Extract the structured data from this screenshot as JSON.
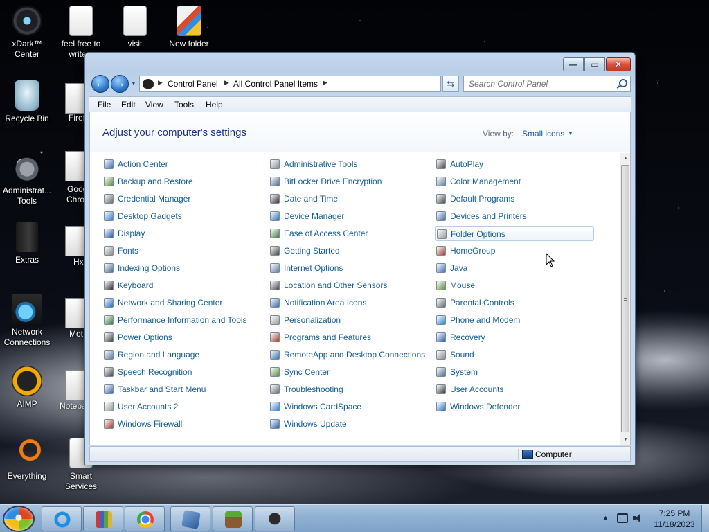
{
  "desktop": {
    "icons": [
      {
        "label": "xDark™ Center",
        "icon": "xdark-icon"
      },
      {
        "label": "feel free to write a",
        "icon": "document-icon"
      },
      {
        "label": "visit",
        "icon": "document-icon"
      },
      {
        "label": "New folder",
        "icon": "folder-icon"
      },
      {
        "label": "Recycle Bin",
        "icon": "recycle-bin-icon"
      },
      {
        "label": "Administrat... Tools",
        "icon": "admin-tools-icon"
      },
      {
        "label": "Extras",
        "icon": "folder-icon"
      },
      {
        "label": "Network Connections",
        "icon": "network-icon"
      },
      {
        "label": "AIMP",
        "icon": "aimp-icon"
      },
      {
        "label": "Everything",
        "icon": "everything-icon"
      },
      {
        "label": "Smart Services",
        "icon": "app-icon"
      }
    ],
    "partial_labels": [
      "Firef",
      "Goog",
      "Chro",
      "Hxl",
      "Mot",
      "Notepa"
    ]
  },
  "window": {
    "controls": {
      "minimize": "—",
      "maximize": "▭",
      "close": "✕"
    },
    "address": {
      "crumbs": [
        "Control Panel",
        "All Control Panel Items"
      ],
      "search_placeholder": "Search Control Panel"
    },
    "menu": [
      "File",
      "Edit",
      "View",
      "Tools",
      "Help"
    ],
    "title": "Adjust your computer's settings",
    "view_by_label": "View by:",
    "view_by_value": "Small icons",
    "columns": [
      [
        "Action Center",
        "Backup and Restore",
        "Credential Manager",
        "Desktop Gadgets",
        "Display",
        "Fonts",
        "Indexing Options",
        "Keyboard",
        "Network and Sharing Center",
        "Performance Information and Tools",
        "Power Options",
        "Region and Language",
        "Speech Recognition",
        "Taskbar and Start Menu",
        "User Accounts 2",
        "Windows Firewall"
      ],
      [
        "Administrative Tools",
        "BitLocker Drive Encryption",
        "Date and Time",
        "Device Manager",
        "Ease of Access Center",
        "Getting Started",
        "Internet Options",
        "Location and Other Sensors",
        "Notification Area Icons",
        "Personalization",
        "Programs and Features",
        "RemoteApp and Desktop Connections",
        "Sync Center",
        "Troubleshooting",
        "Windows CardSpace",
        "Windows Update"
      ],
      [
        "AutoPlay",
        "Color Management",
        "Default Programs",
        "Devices and Printers",
        "Folder Options",
        "HomeGroup",
        "Java",
        "Mouse",
        "Parental Controls",
        "Phone and Modem",
        "Recovery",
        "Sound",
        "System",
        "User Accounts",
        "Windows Defender"
      ]
    ],
    "hovered_item": "Folder Options",
    "status_bar": {
      "location": "Computer"
    }
  },
  "taskbar": {
    "pinned": [
      "internet-explorer-icon",
      "winrar-icon",
      "chrome-icon",
      "virtualbox-icon",
      "minecraft-icon",
      "tool-icon"
    ],
    "clock": {
      "time": "7:25 PM",
      "date": "11/18/2023"
    }
  },
  "colors": {
    "link": "#155f96",
    "title": "#1e3287",
    "window_frame": "#c3d6ec",
    "taskbar": "#8fb0d2"
  }
}
